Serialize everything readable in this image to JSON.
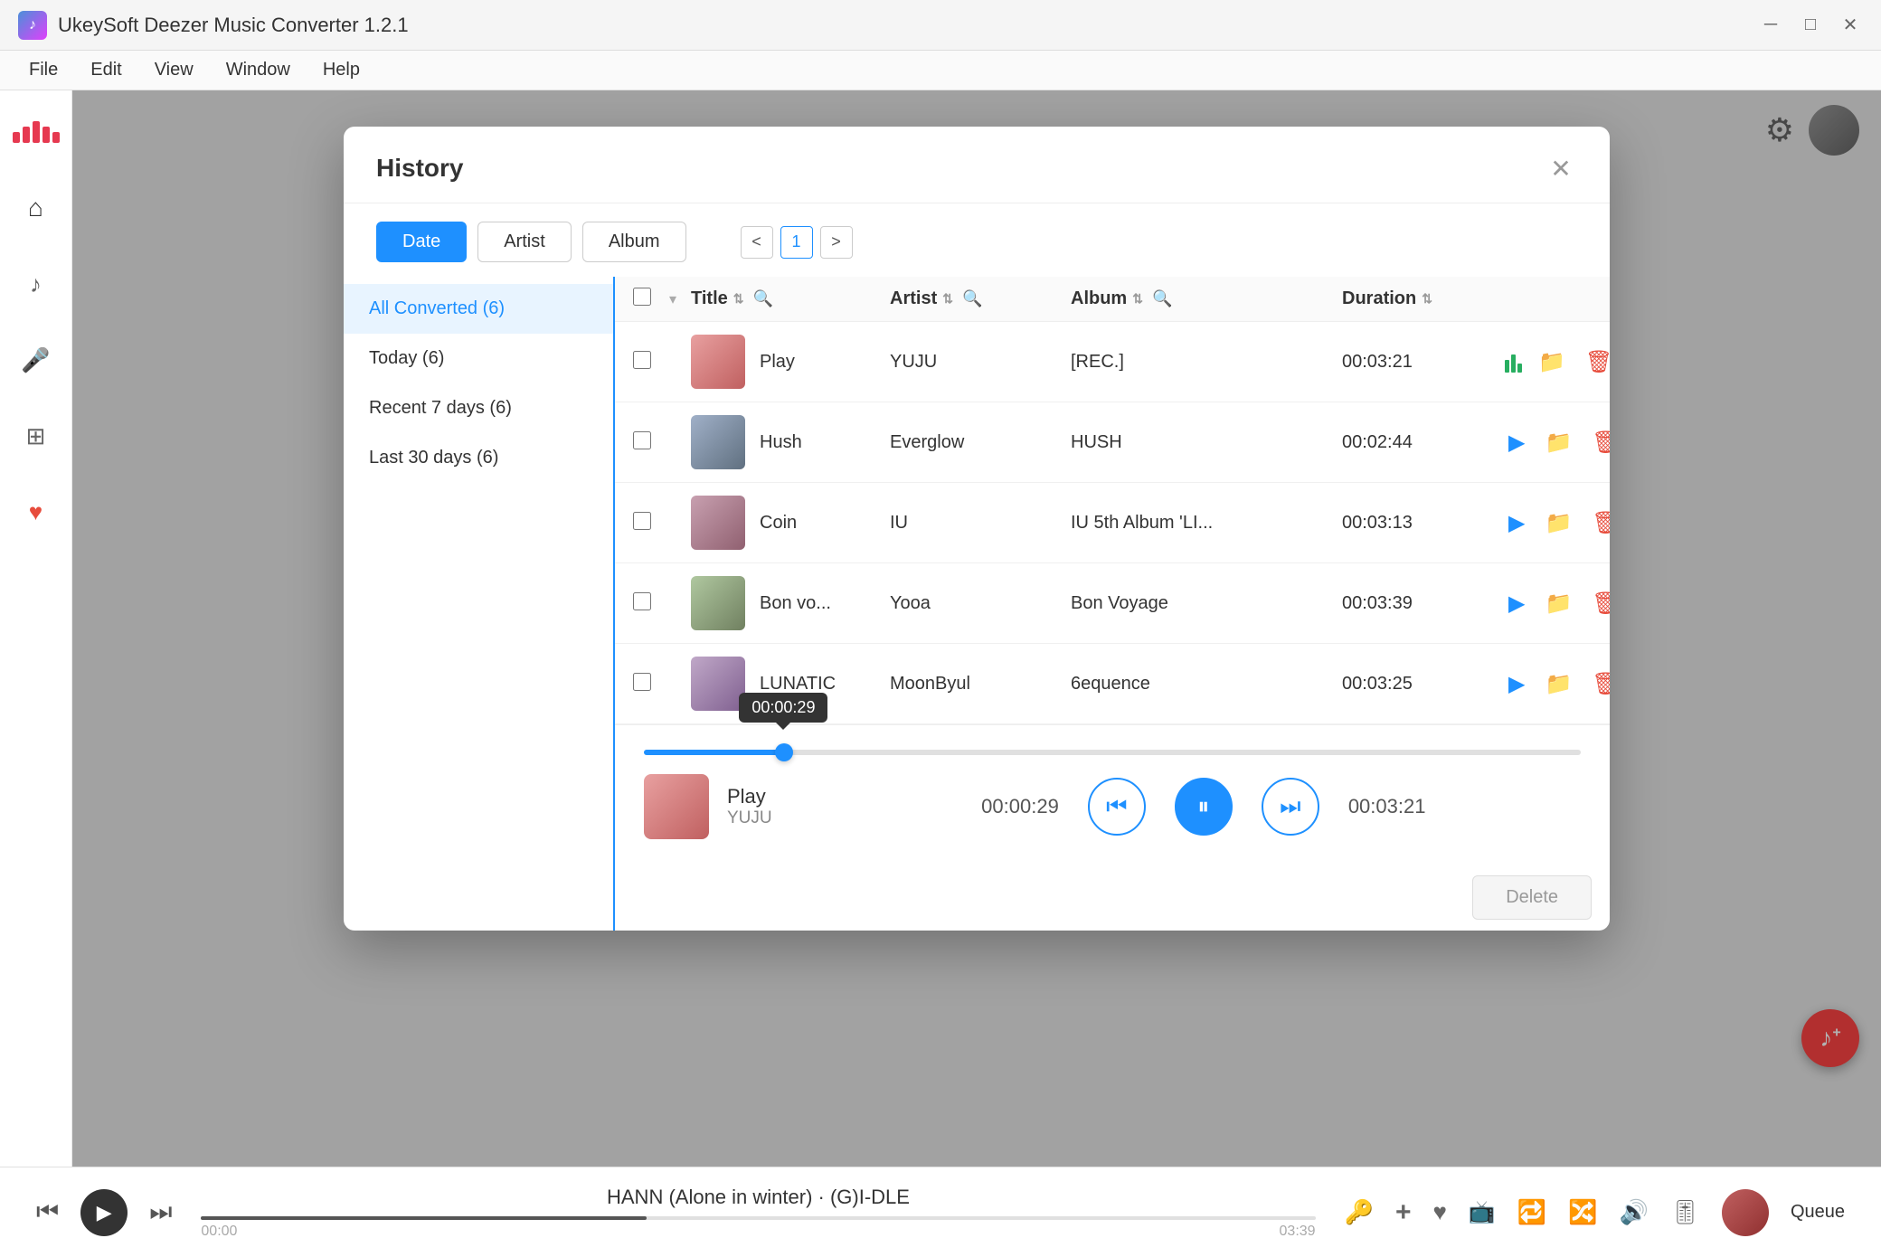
{
  "app": {
    "title": "UkeySoft Deezer Music Converter 1.2.1",
    "menu": [
      "File",
      "Edit",
      "View",
      "Window",
      "Help"
    ]
  },
  "modal": {
    "title": "History",
    "tabs": [
      "Date",
      "Artist",
      "Album"
    ],
    "active_tab": "Date",
    "pagination": {
      "current": 1,
      "prev": "<",
      "next": ">"
    },
    "left_panel": [
      {
        "label": "All Converted (6)",
        "active": true
      },
      {
        "label": "Today (6)",
        "active": false
      },
      {
        "label": "Recent 7 days (6)",
        "active": false
      },
      {
        "label": "Last 30 days (6)",
        "active": false
      }
    ],
    "table": {
      "headers": {
        "title": "Title",
        "artist": "Artist",
        "album": "Album",
        "duration": "Duration"
      },
      "rows": [
        {
          "id": 1,
          "title": "Play",
          "artist": "YUJU",
          "album": "[REC.]",
          "duration": "00:03:21",
          "playing": true,
          "thumb_class": "thumb-play"
        },
        {
          "id": 2,
          "title": "Hush",
          "artist": "Everglow",
          "album": "HUSH",
          "duration": "00:02:44",
          "playing": false,
          "thumb_class": "thumb-hush"
        },
        {
          "id": 3,
          "title": "Coin",
          "artist": "IU",
          "album": "IU 5th Album 'LI...",
          "duration": "00:03:13",
          "playing": false,
          "thumb_class": "thumb-coin"
        },
        {
          "id": 4,
          "title": "Bon vo...",
          "artist": "Yooa",
          "album": "Bon Voyage",
          "duration": "00:03:39",
          "playing": false,
          "thumb_class": "thumb-bon"
        },
        {
          "id": 5,
          "title": "LUNATIC",
          "artist": "MoonByul",
          "album": "6equence",
          "duration": "00:03:25",
          "playing": false,
          "thumb_class": "thumb-lunatic"
        }
      ]
    },
    "player": {
      "track_name": "Play",
      "artist": "YUJU",
      "current_time": "00:00:29",
      "total_time": "00:03:21",
      "progress_percent": 15,
      "tooltip_time": "00:00:29"
    },
    "delete_btn": "Delete"
  },
  "global_player": {
    "track": "HANN (Alone in winter) · (G)I-DLE",
    "time_start": "00:00",
    "time_end": "03:39",
    "queue_label": "Queue"
  },
  "icons": {
    "home": "⌂",
    "mic": "🎤",
    "grid": "⊞",
    "heart": "♥",
    "settings": "⚙",
    "close": "✕",
    "search": "🔍",
    "sort_up": "↑",
    "sort_down": "↓",
    "play": "▶",
    "pause": "⏸",
    "prev": "⏮",
    "next": "⏭",
    "folder": "📂",
    "trash": "🗑",
    "key": "🔑",
    "plus": "+",
    "love": "♥",
    "cast": "📺",
    "repeat": "🔁",
    "shuffle": "🔀",
    "volume": "🔊",
    "equalizer": "🎚",
    "minimize": "─",
    "maximize": "□",
    "window_close": "✕",
    "skip_back": "⏮",
    "skip_fwd": "⏭",
    "music_note": "♪",
    "add_music": "+"
  }
}
